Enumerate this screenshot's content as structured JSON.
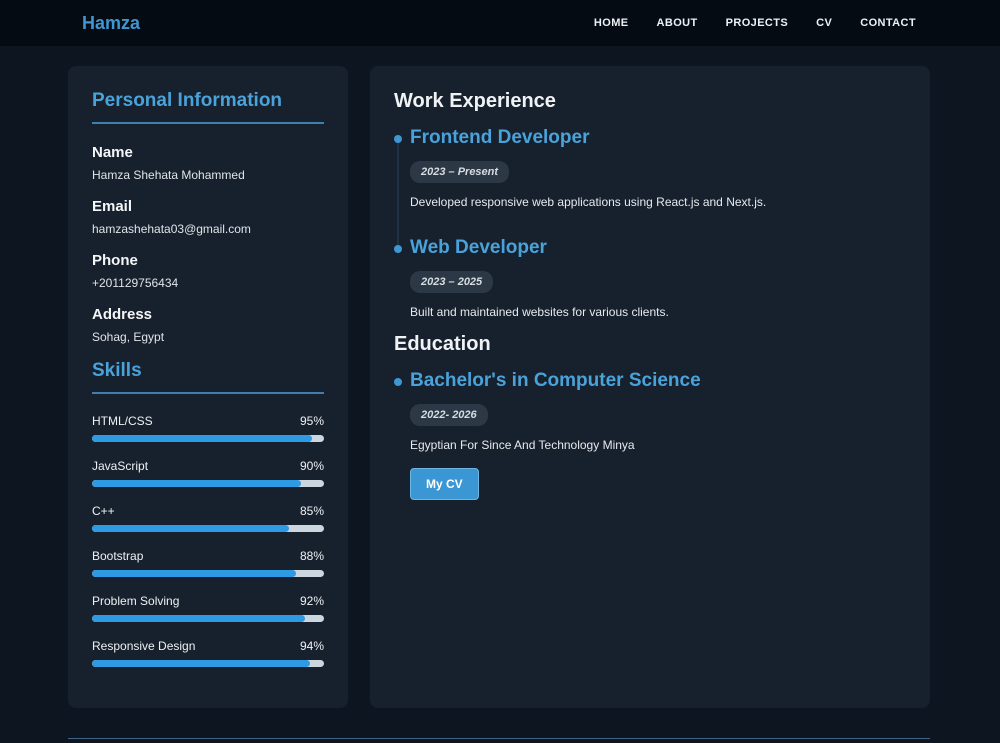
{
  "navbar": {
    "brand": "Hamza",
    "items": [
      {
        "label": "HOME"
      },
      {
        "label": "ABOUT"
      },
      {
        "label": "PROJECTS"
      },
      {
        "label": "CV"
      },
      {
        "label": "CONTACT"
      }
    ]
  },
  "personal_info": {
    "title": "Personal Information",
    "fields": [
      {
        "label": "Name",
        "value": "Hamza Shehata Mohammed"
      },
      {
        "label": "Email",
        "value": "hamzashehata03@gmail.com"
      },
      {
        "label": "Phone",
        "value": "+201129756434"
      },
      {
        "label": "Address",
        "value": "Sohag, Egypt"
      }
    ]
  },
  "skills": {
    "title": "Skills",
    "items": [
      {
        "label": "HTML/CSS",
        "percent": "95%",
        "value": 95
      },
      {
        "label": "JavaScript",
        "percent": "90%",
        "value": 90
      },
      {
        "label": "C++",
        "percent": "85%",
        "value": 85
      },
      {
        "label": "Bootstrap",
        "percent": "88%",
        "value": 88
      },
      {
        "label": "Problem Solving",
        "percent": "92%",
        "value": 92
      },
      {
        "label": "Responsive Design",
        "percent": "94%",
        "value": 94
      }
    ]
  },
  "experience": {
    "title": "Work Experience",
    "items": [
      {
        "role": "Frontend Developer",
        "period": "2023 – Present",
        "description": "Developed responsive web applications using React.js and Next.js."
      },
      {
        "role": "Web Developer",
        "period": "2023 – 2025",
        "description": "Built and maintained websites for various clients."
      }
    ]
  },
  "education": {
    "title": "Education",
    "degree": "Bachelor's in Computer Science",
    "period": "2022- 2026",
    "school": "Egyptian For Since And Technology Minya",
    "cv_button": "My CV"
  },
  "colors": {
    "accent": "#4aa2db",
    "progress_fill": "#2e9ae4",
    "navbar_bg": "#050b12",
    "card_bg": "#17212d",
    "page_bg": "#0d1520"
  }
}
